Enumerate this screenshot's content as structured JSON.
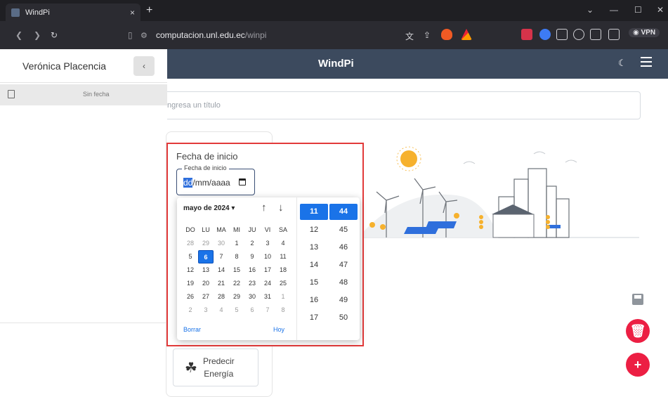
{
  "browser": {
    "tab_title": "WindPi",
    "tab_close": "×",
    "new_tab": "+",
    "url_host": "computacion.unl.edu.ec",
    "url_path": "/winpi",
    "vpn_label": "◉ VPN",
    "win_min": "—",
    "win_max": "☐",
    "win_close": "✕"
  },
  "header": {
    "app_title": "WindPi"
  },
  "sidebar": {
    "user_name": "Verónica Placencia",
    "collapse": "‹",
    "items": [
      {
        "date": "Sin fecha"
      }
    ]
  },
  "main": {
    "title_placeholder": "Ingresa un título",
    "start_date_heading": "Fecha de inicio",
    "start_date_legend": "Fecha de inicio",
    "date_value_dd": "dd",
    "date_value_rest": "/mm/aaaa",
    "predict_label": "Predecir\nEnergía"
  },
  "datepicker": {
    "month_label": "mayo de 2024 ▾",
    "weekdays": [
      "DO",
      "LU",
      "MA",
      "MI",
      "JU",
      "VI",
      "SA"
    ],
    "weeks": [
      [
        "28",
        "29",
        "30",
        "1",
        "2",
        "3",
        "4"
      ],
      [
        "5",
        "6",
        "7",
        "8",
        "9",
        "10",
        "11"
      ],
      [
        "12",
        "13",
        "14",
        "15",
        "16",
        "17",
        "18"
      ],
      [
        "19",
        "20",
        "21",
        "22",
        "23",
        "24",
        "25"
      ],
      [
        "26",
        "27",
        "28",
        "29",
        "30",
        "31",
        "1"
      ],
      [
        "2",
        "3",
        "4",
        "5",
        "6",
        "7",
        "8"
      ]
    ],
    "selected_day": "6",
    "clear_label": "Borrar",
    "today_label": "Hoy",
    "hours": [
      "11",
      "12",
      "13",
      "14",
      "15",
      "16",
      "17"
    ],
    "minutes": [
      "44",
      "45",
      "46",
      "47",
      "48",
      "49",
      "50"
    ],
    "selected_hour": "11",
    "selected_minute": "44"
  },
  "colors": {
    "accent": "#1a73e8",
    "header_bg": "#3c4a5e",
    "fab": "#ec1f43",
    "highlight": "#e23a3a"
  }
}
